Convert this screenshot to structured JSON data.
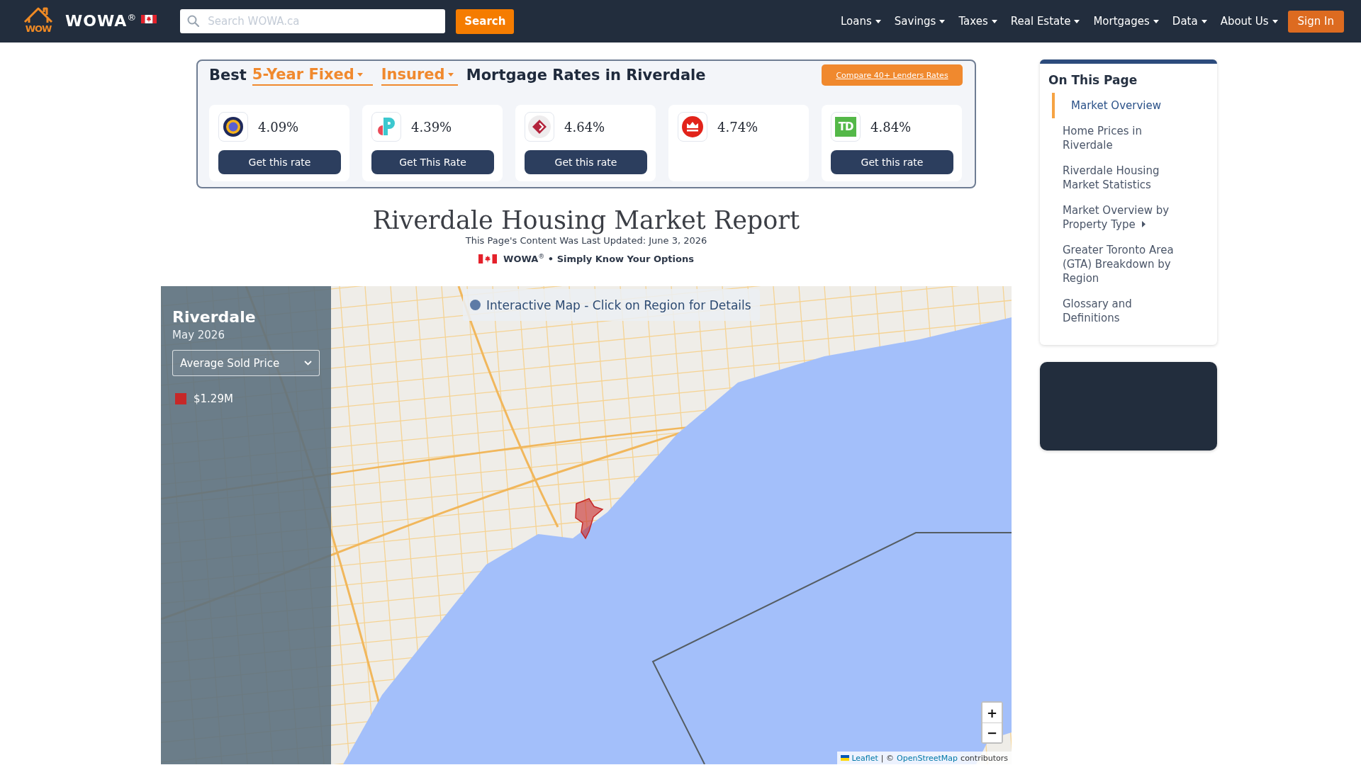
{
  "navbar": {
    "logo_text": "WOW",
    "brand": "WOWA$^{®}$",
    "search": {
      "placeholder": "Search WOWA.ca"
    },
    "search_button": "Search",
    "menu": [
      {
        "label": "Loans"
      },
      {
        "label": "Savings"
      },
      {
        "label": "Taxes"
      },
      {
        "label": "Real Estate"
      },
      {
        "label": "Mortgages"
      },
      {
        "label": "Data"
      },
      {
        "label": "About Us"
      }
    ],
    "sign_in": "Sign In"
  },
  "rates": {
    "lead": "Best",
    "term": "5-Year Fixed",
    "insurance": "Insured",
    "heading": "Mortgage Rates in Riverdale",
    "compare_button": "Compare 40+ Lenders Rates",
    "offers": [
      {
        "logo": {
          "kind": "ring"
        },
        "rate": "4.09%",
        "button": "Get this rate"
      },
      {
        "logo": {
          "kind": "split-p"
        },
        "rate": "4.39%",
        "button": "Get This Rate"
      },
      {
        "logo": {
          "kind": "diamond"
        },
        "rate": "4.64%",
        "button": "Get this rate"
      },
      {
        "logo": {
          "kind": "disc"
        },
        "rate": "4.74%"
      },
      {
        "logo": {
          "kind": "letters",
          "text": "TD"
        },
        "rate": "4.84%",
        "button": "Get this rate"
      }
    ]
  },
  "report": {
    "title": "Riverdale Housing Market Report",
    "updated": "This Page's Content Was Last Updated: June 3, 2026",
    "tagline": "WOWA$^{®}$ • Simply Know Your Options"
  },
  "map": {
    "banner": "Interactive Map - Click on Region for Details",
    "panel": {
      "title": "Riverdale",
      "date": "May 2026",
      "metric": "Average Sold Price",
      "legend": [
        {
          "label": "$1.29M",
          "color": "#c62828"
        }
      ]
    },
    "zoom": {
      "in": "+",
      "out": "−"
    },
    "attribution": {
      "leaflet": "Leaflet",
      "separator": "| ©",
      "osm": "OpenStreetMap",
      "suffix": "contributors"
    }
  },
  "sidebar": {
    "title": "On This Page",
    "items": [
      {
        "label": "Market Overview",
        "selected": true,
        "has_submenu": false
      },
      {
        "label": "Home Prices in Riverdale",
        "selected": false,
        "has_submenu": false
      },
      {
        "label": "Riverdale Housing Market Statistics",
        "selected": false,
        "has_submenu": false
      },
      {
        "label": "Market Overview by Property Type",
        "selected": false,
        "has_submenu": true
      },
      {
        "label": "Greater Toronto Area (GTA) Breakdown by Region",
        "selected": false,
        "has_submenu": false
      },
      {
        "label": "Glossary and Definitions",
        "selected": false,
        "has_submenu": false
      }
    ]
  }
}
